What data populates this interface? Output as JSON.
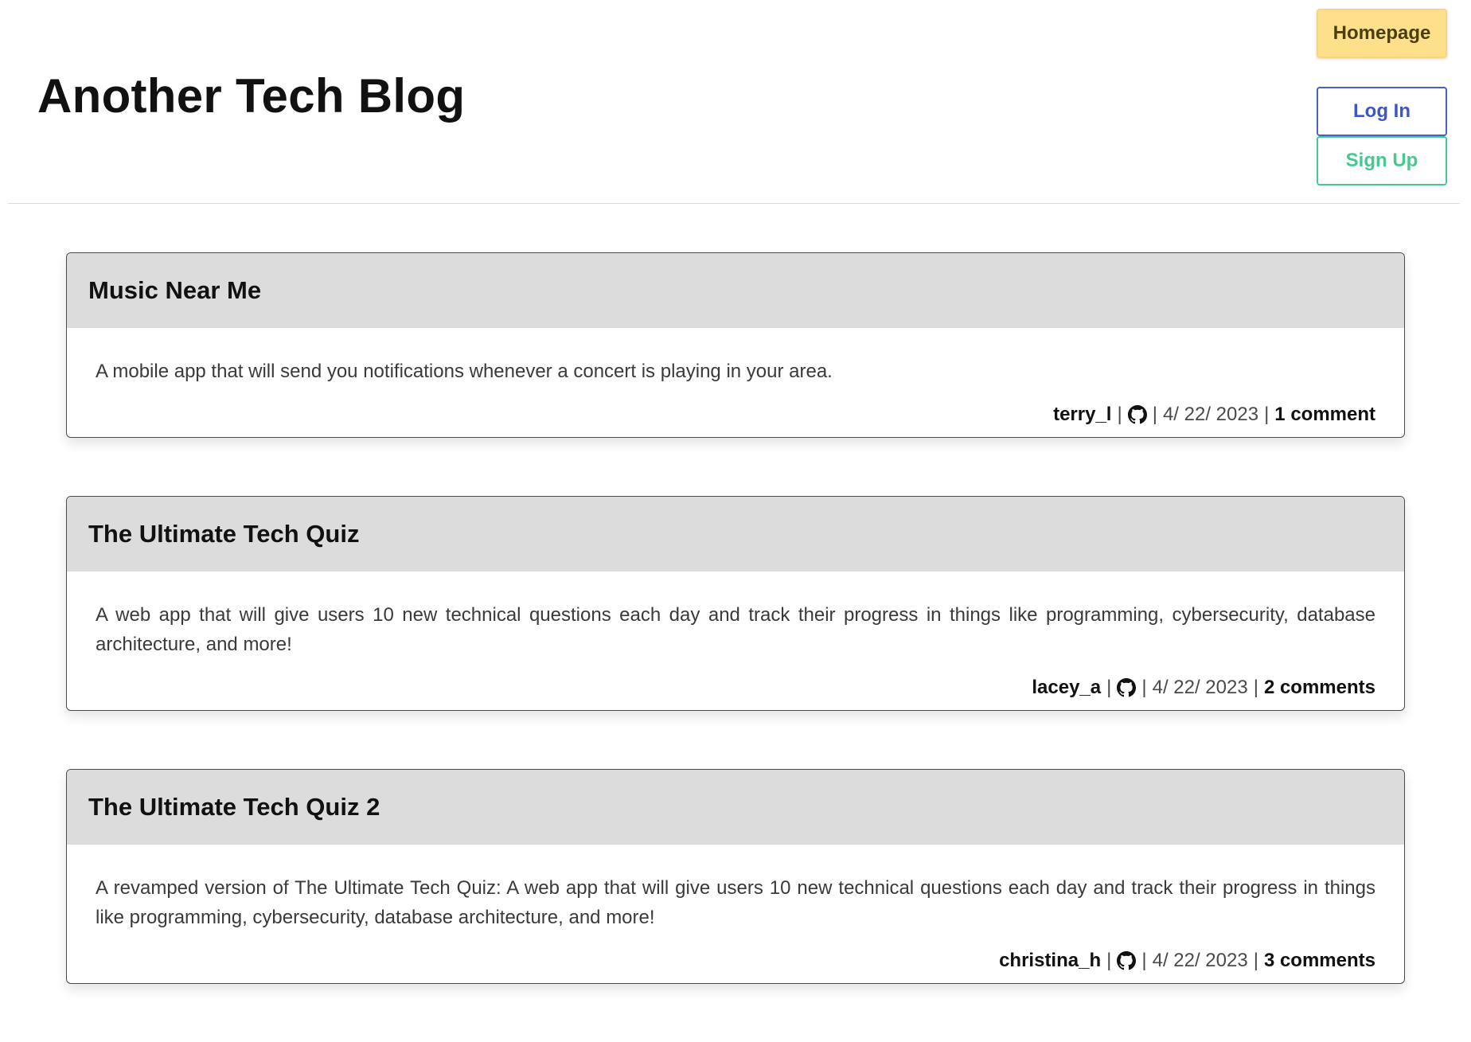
{
  "header": {
    "title": "Another Tech Blog",
    "nav": {
      "homepage": "Homepage",
      "login": "Log In",
      "signup": "Sign Up"
    }
  },
  "colors": {
    "homepage_bg": "#ffe08a",
    "login": "#3e56c4",
    "signup": "#48c78e",
    "card_header_bg": "#dcdcdc"
  },
  "posts": [
    {
      "title": "Music Near Me",
      "body": "A mobile app that will send you notifications whenever a concert is playing in your area.",
      "author": "terry_l",
      "icon": "github-icon",
      "separator": "|",
      "date": "4/ 22/ 2023",
      "comments": "1 comment"
    },
    {
      "title": "The Ultimate Tech Quiz",
      "body": "A web app that will give users 10 new technical questions each day and track their progress in things like programming, cybersecurity, database architecture, and more!",
      "author": "lacey_a",
      "icon": "github-icon",
      "separator": "|",
      "date": "4/ 22/ 2023",
      "comments": "2 comments"
    },
    {
      "title": "The Ultimate Tech Quiz 2",
      "body": "A revamped version of The Ultimate Tech Quiz: A web app that will give users 10 new technical questions each day and track their progress in things like programming, cybersecurity, database architecture, and more!",
      "author": "christina_h",
      "icon": "github-icon",
      "separator": "|",
      "date": "4/ 22/ 2023",
      "comments": "3 comments"
    }
  ]
}
